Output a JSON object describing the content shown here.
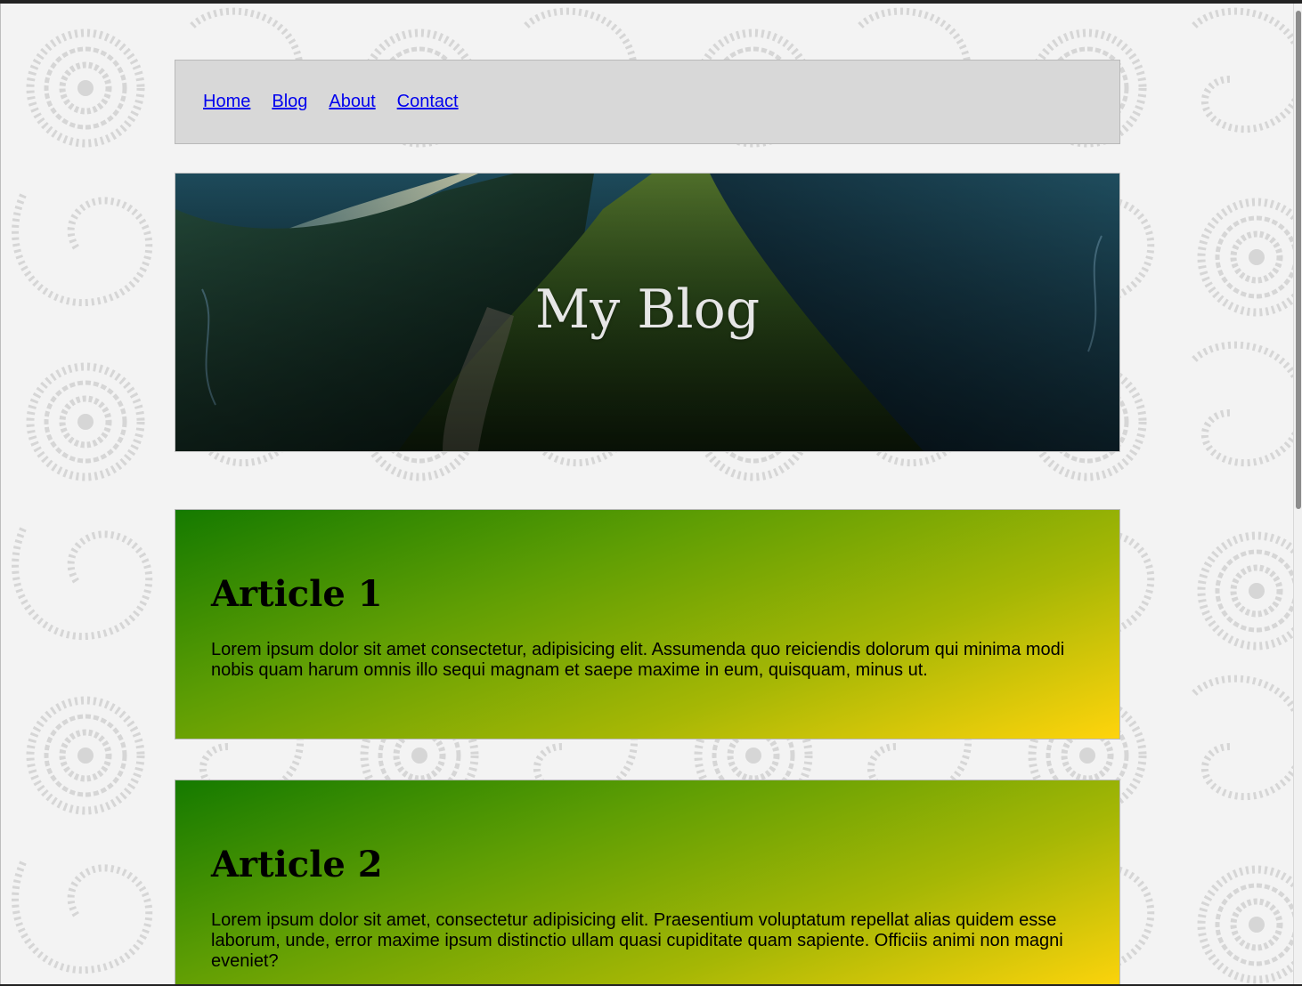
{
  "nav": {
    "links": [
      "Home",
      "Blog",
      "About",
      "Contact"
    ]
  },
  "hero": {
    "title": "My Blog"
  },
  "articles": [
    {
      "title": "Article 1",
      "body": "Lorem ipsum dolor sit amet consectetur, adipisicing elit. Assumenda quo reiciendis dolorum qui minima modi nobis quam harum omnis illo sequi magnam et saepe maxime in eum, quisquam, minus ut."
    },
    {
      "title": "Article 2",
      "body": "Lorem ipsum dolor sit amet, consectetur adipisicing elit. Praesentium voluptatum repellat alias quidem esse laborum, unde, error maxime ipsum distinctio ullam quasi cupiditate quam sapiente. Officiis animi non magni eveniet?"
    }
  ],
  "colors": {
    "nav_background": "#d8d8d8",
    "link": "#0000ee",
    "article_gradient_start": "#157a00",
    "article_gradient_end": "#ffd40c",
    "page_background": "#f3f3f3",
    "pattern": "#d4d4d4"
  }
}
